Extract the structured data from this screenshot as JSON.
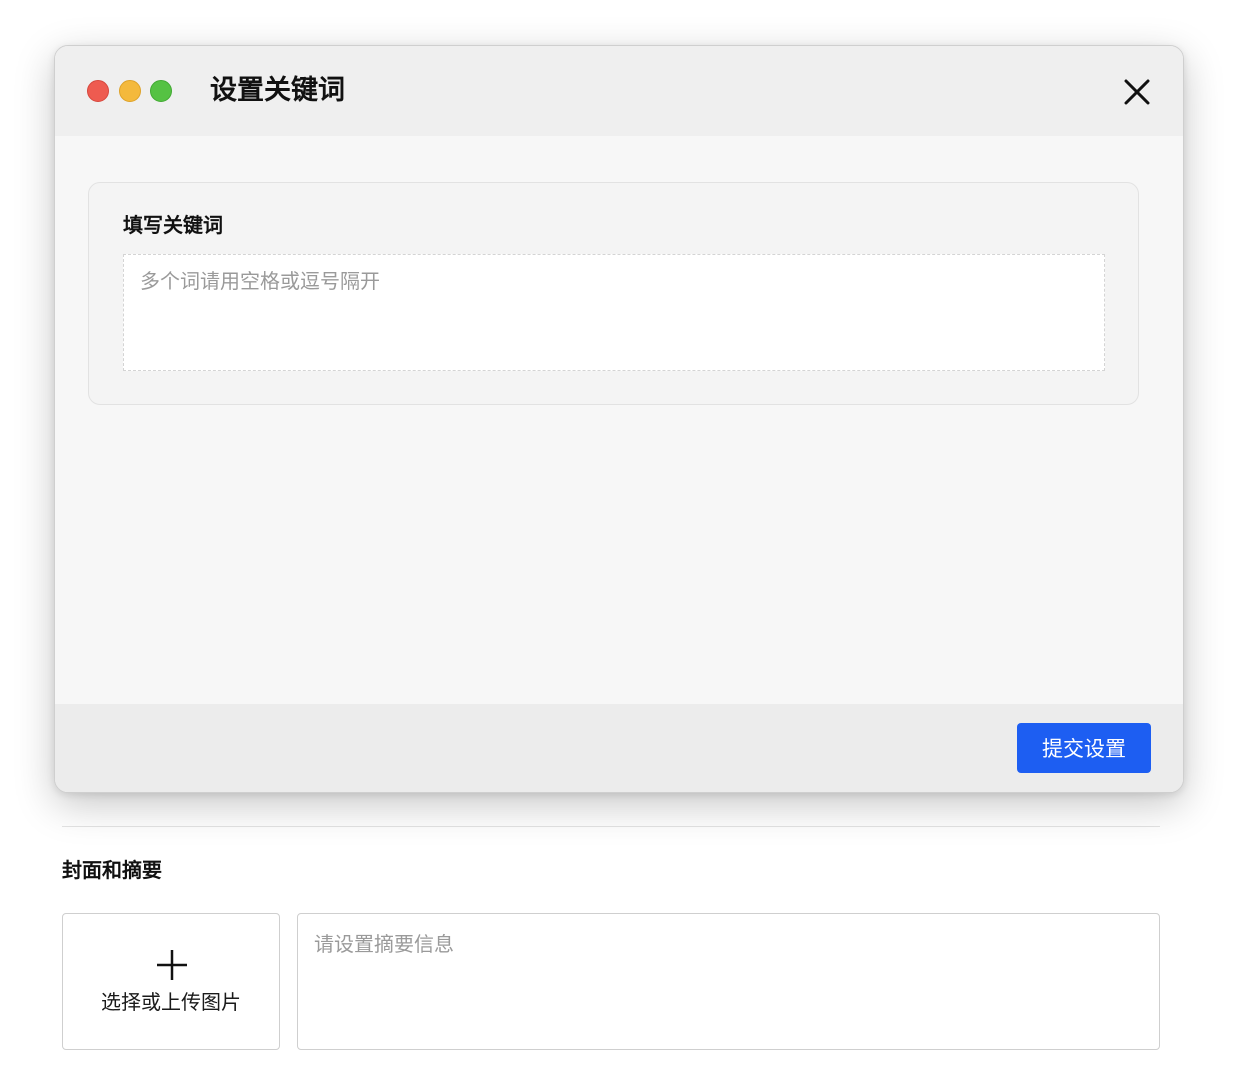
{
  "modal": {
    "title": "设置关键词",
    "window_controls": [
      "close-traffic-light",
      "minimize-traffic-light",
      "zoom-traffic-light"
    ],
    "close_icon": "close-icon",
    "keywords_card": {
      "label": "填写关键词",
      "input_value": "",
      "input_placeholder": "多个词请用空格或逗号隔开"
    },
    "submit_label": "提交设置",
    "colors": {
      "accent": "#1d5ef2",
      "traffic_red": "#ee5b50",
      "traffic_yellow": "#f4b93c",
      "traffic_green": "#55c243"
    }
  },
  "background": {
    "section_title": "封面和摘要",
    "cover_upload": {
      "icon": "plus-icon",
      "label": "选择或上传图片"
    },
    "summary": {
      "value": "",
      "placeholder": "请设置摘要信息"
    }
  }
}
